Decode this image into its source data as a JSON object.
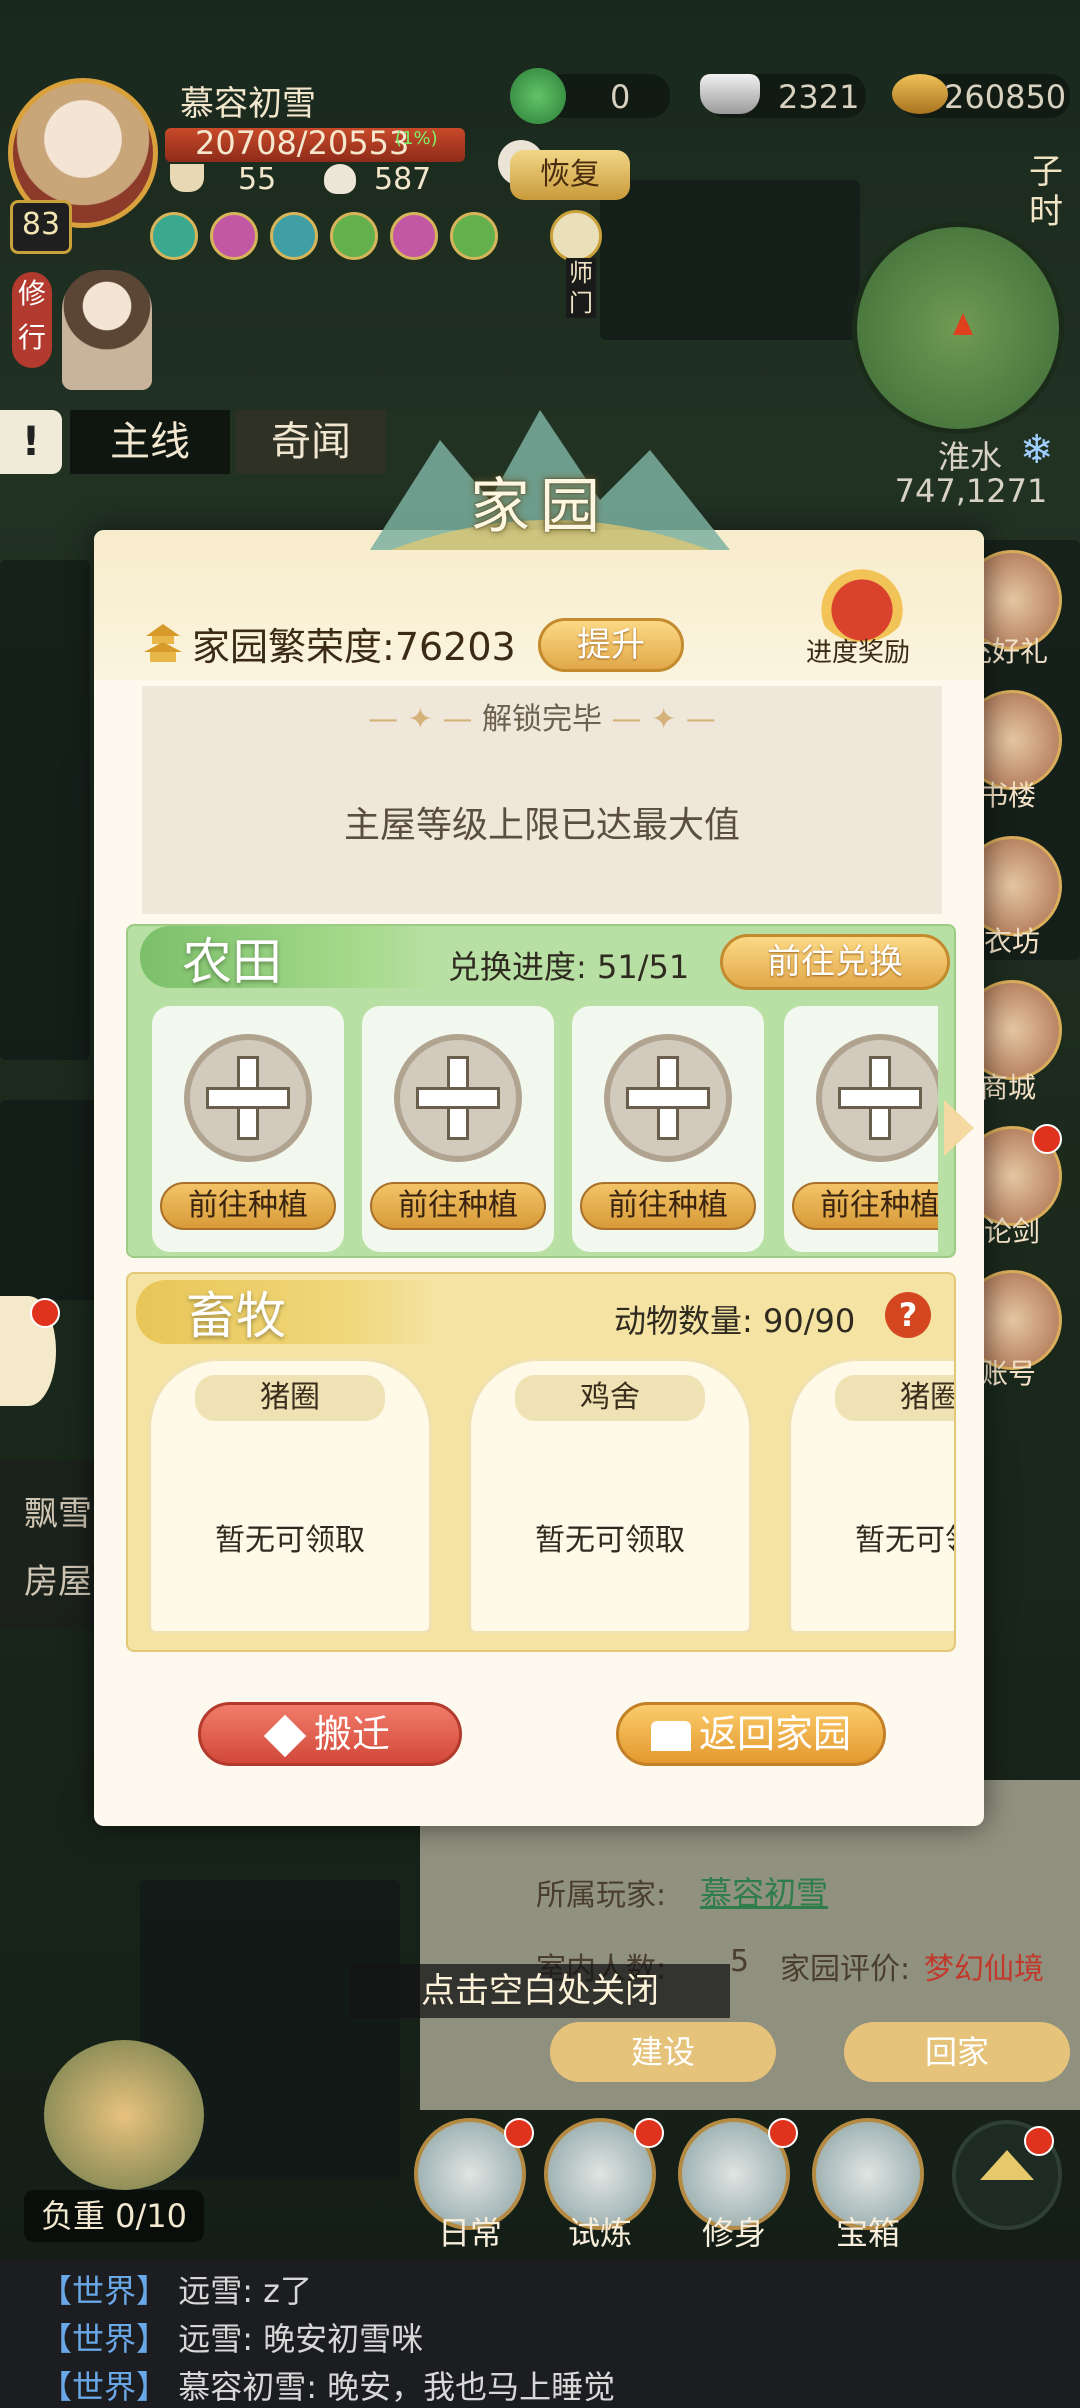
{
  "hud": {
    "player_name": "慕容初雪",
    "hp_text": "20708/20553",
    "hp_percent_label": "(1%)",
    "level": "83",
    "stat_food": "55",
    "stat_dumpling": "587",
    "currency_jade": "0",
    "currency_silver": "2321",
    "currency_coins": "260850",
    "recover_label": "恢复",
    "cultivate_label": "修行",
    "sect_label": "师门",
    "hour_label": "子时",
    "location": "淮水",
    "coords": "747,1271"
  },
  "quest_tabs": [
    "主线",
    "奇闻"
  ],
  "side_menu": [
    "充好礼",
    "书楼",
    "成衣坊",
    "商城",
    "仙论剑",
    "账号"
  ],
  "left_panel": {
    "line1": "飘雪",
    "line2": "房屋"
  },
  "modal": {
    "title": "家园",
    "prosperity_label": "家园繁荣度:",
    "prosperity_value": "76203",
    "upgrade_label": "提升",
    "reward_label": "进度奖励",
    "unlock_title": "解锁完毕",
    "unlock_message": "主屋等级上限已达最大值",
    "farm": {
      "title": "农田",
      "progress_label": "兑换进度:",
      "progress_value": "51/51",
      "exchange_label": "前往兑换",
      "plots": [
        {
          "action": "前往种植"
        },
        {
          "action": "前往种植"
        },
        {
          "action": "前往种植"
        },
        {
          "action": "前往种植"
        }
      ]
    },
    "livestock": {
      "title": "畜牧",
      "count_label": "动物数量:",
      "count_value": "90/90",
      "help": "?",
      "pens": [
        {
          "name": "猪圈",
          "status": "暂无可领取"
        },
        {
          "name": "鸡舍",
          "status": "暂无可领取"
        },
        {
          "name": "猪圈",
          "status": "暂无可领取"
        }
      ]
    },
    "move_label": "搬迁",
    "return_label": "返回家园"
  },
  "close_hint": "点击空白处关闭",
  "house_info": {
    "owner_label": "所属玩家:",
    "owner_value": "慕容初雪",
    "occupants_label": "室内人数:",
    "occupants_value": "5",
    "rating_label": "家园评价:",
    "rating_value": "梦幻仙境",
    "build_label": "建设",
    "home_label": "回家"
  },
  "bottom_nav": [
    {
      "label": "日常"
    },
    {
      "label": "试炼"
    },
    {
      "label": "修身"
    },
    {
      "label": "宝箱"
    }
  ],
  "weight_label": "负重 0/10",
  "chat": [
    {
      "channel": "【世界】",
      "text": "远雪: z了"
    },
    {
      "channel": "【世界】",
      "text": "远雪: 晚安初雪咪"
    },
    {
      "channel": "【世界】",
      "text": "慕容初雪: 晚安，我也马上睡觉"
    }
  ],
  "colors": {
    "accent_gold": "#e1a84a",
    "farm_green": "#b9e0a4",
    "stock_yellow": "#f4e3a2",
    "danger_red": "#d2483a"
  }
}
